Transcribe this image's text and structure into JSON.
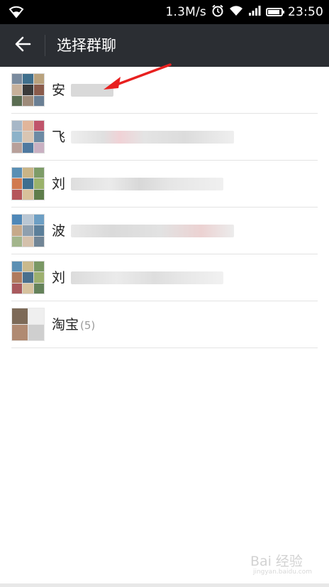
{
  "status_bar": {
    "network_speed": "1.3M/s",
    "time": "23:50",
    "icons": [
      "wifi-icon",
      "alarm-icon",
      "wifi-icon",
      "signal-icon",
      "battery-icon"
    ]
  },
  "header": {
    "title": "选择群聊",
    "back_icon": "back-arrow-icon"
  },
  "groups": [
    {
      "name": "安",
      "count": "",
      "avatar": "grid-9"
    },
    {
      "name": "飞",
      "count": "",
      "avatar": "grid-9"
    },
    {
      "name": "刘",
      "count": "",
      "avatar": "grid-9"
    },
    {
      "name": "波",
      "count": "",
      "avatar": "grid-9"
    },
    {
      "name": "刘",
      "count": "",
      "avatar": "grid-9"
    },
    {
      "name": "淘宝",
      "count": "(5)",
      "avatar": "grid-4"
    }
  ],
  "watermark": {
    "text": "Bai 经验",
    "sub": "jingyan.baidu.com"
  },
  "colors": {
    "status_bar": "#000000",
    "title_bar": "#2b2e33",
    "annotation_arrow": "#e8201f"
  }
}
